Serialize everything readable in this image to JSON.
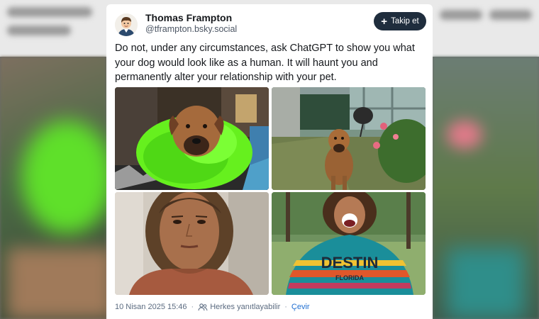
{
  "post": {
    "author_name": "Thomas Frampton",
    "author_handle": "@tframpton.bsky.social",
    "follow_label": "Takip et",
    "text": "Do not, under any circumstances, ask ChatGPT to show you what your dog would look like as a human. It will haunt you and permanently alter your relationship with your pet.",
    "timestamp": "10 Nisan 2025 15:46",
    "reply_setting": "Herkes yanıtlayabilir",
    "translate_label": "Çevir",
    "images": [
      {
        "icon": "dog-green-ruff-photo"
      },
      {
        "icon": "dog-backyard-photo"
      },
      {
        "icon": "woman-serious-portrait-photo"
      },
      {
        "icon": "woman-laughing-destin-hoodie-photo"
      }
    ],
    "hoodie_text": [
      "DESTIN",
      "FLORIDA"
    ]
  },
  "colors": {
    "button_bg": "#1f2d3d",
    "link": "#1f6fd1",
    "meta_text": "#5b6b80"
  }
}
